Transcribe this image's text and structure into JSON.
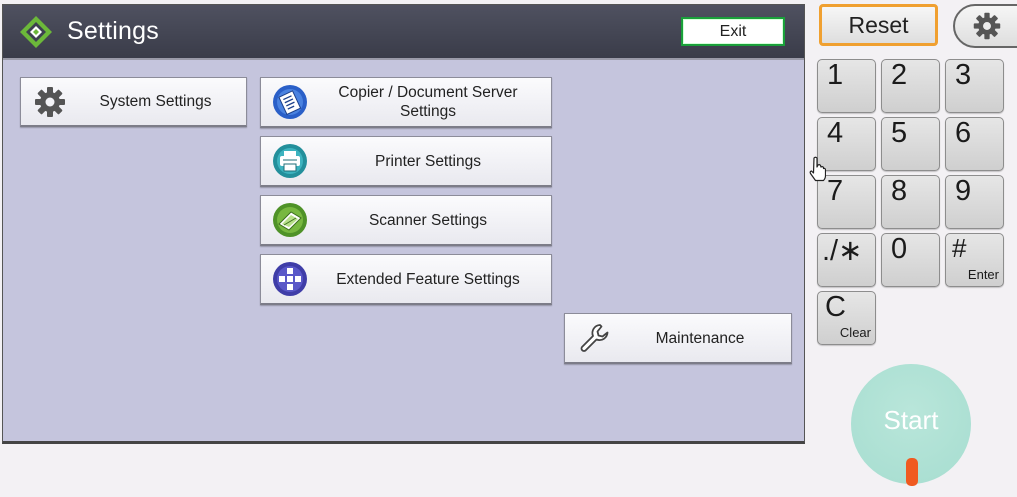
{
  "header": {
    "title": "Settings",
    "exit_label": "Exit"
  },
  "menu": {
    "system_settings": "System Settings",
    "copier_line1": "Copier / Document Server",
    "copier_line2": "Settings",
    "printer_settings": "Printer Settings",
    "scanner_settings": "Scanner Settings",
    "extended_feature_settings": "Extended Feature Settings",
    "maintenance": "Maintenance"
  },
  "side": {
    "reset_label": "Reset",
    "start_label": "Start",
    "keys": {
      "k1": "1",
      "k2": "2",
      "k3": "3",
      "k4": "4",
      "k5": "5",
      "k6": "6",
      "k7": "7",
      "k8": "8",
      "k9": "9",
      "dot_star": "./∗",
      "k0": "0",
      "hash": "#",
      "hash_sub": "Enter",
      "clear": "C",
      "clear_sub": "Clear"
    }
  },
  "colors": {
    "panel_bg": "#c5c5dd",
    "titlebar": "#44465a",
    "exit_border": "#1aa03a",
    "reset_border": "#f0a030",
    "start": "#a6ddd0",
    "start_led": "#f05a20",
    "copier_icon": "#2a5fc8",
    "printer_icon": "#2a9aa6",
    "scanner_icon": "#5aa030",
    "extended_icon": "#4a48b0"
  },
  "icons": {
    "logo": "diamond-logo-icon",
    "system": "gear-icon",
    "copier": "document-icon",
    "printer": "printer-icon",
    "scanner": "scanner-icon",
    "extended": "plus-cross-icon",
    "maintenance": "wrench-icon",
    "tab": "gear-icon",
    "cursor": "hand-pointer-icon"
  }
}
